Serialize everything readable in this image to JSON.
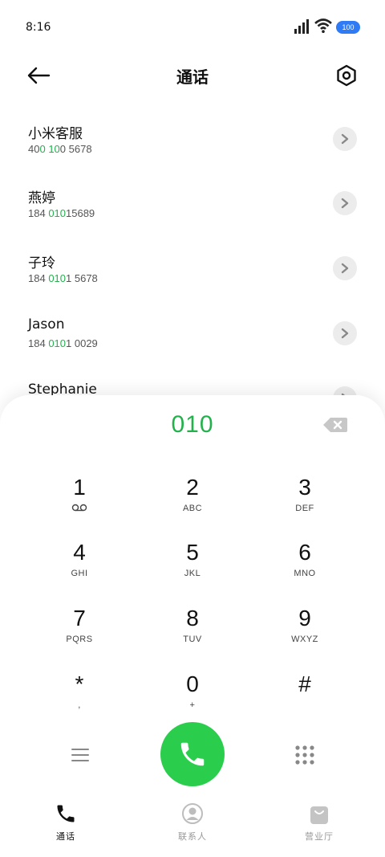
{
  "status": {
    "time": "8:16",
    "battery": "100"
  },
  "header": {
    "title": "通话"
  },
  "contacts": [
    {
      "name": "小米客服",
      "num_parts": [
        {
          "t": "40",
          "h": false
        },
        {
          "t": "0",
          "h": true
        },
        {
          "t": " ",
          "h": false
        },
        {
          "t": "10",
          "h": true
        },
        {
          "t": "0 5678",
          "h": false
        }
      ]
    },
    {
      "name": "燕婷",
      "num_parts": [
        {
          "t": "184 ",
          "h": false
        },
        {
          "t": "010",
          "h": true
        },
        {
          "t": "15689",
          "h": false
        }
      ]
    },
    {
      "name": "子玲",
      "num_parts": [
        {
          "t": "184 ",
          "h": false
        },
        {
          "t": "010",
          "h": true
        },
        {
          "t": "1 5678",
          "h": false
        }
      ]
    },
    {
      "name": "Jason",
      "num_parts": [
        {
          "t": "184 ",
          "h": false
        },
        {
          "t": "010",
          "h": true
        },
        {
          "t": "1 0029",
          "h": false
        }
      ]
    },
    {
      "name": "Stephanie",
      "num_parts": []
    }
  ],
  "dialer": {
    "input": "010",
    "keys": [
      {
        "digit": "1",
        "letters": ""
      },
      {
        "digit": "2",
        "letters": "ABC"
      },
      {
        "digit": "3",
        "letters": "DEF"
      },
      {
        "digit": "4",
        "letters": "GHI"
      },
      {
        "digit": "5",
        "letters": "JKL"
      },
      {
        "digit": "6",
        "letters": "MNO"
      },
      {
        "digit": "7",
        "letters": "PQRS"
      },
      {
        "digit": "8",
        "letters": "TUV"
      },
      {
        "digit": "9",
        "letters": "WXYZ"
      },
      {
        "digit": "*",
        "letters": ","
      },
      {
        "digit": "0",
        "letters": "+"
      },
      {
        "digit": "#",
        "letters": ""
      }
    ]
  },
  "nav": {
    "tabs": [
      {
        "label": "通话",
        "icon": "phone-icon",
        "active": true
      },
      {
        "label": "联系人",
        "icon": "contact-icon",
        "active": false
      },
      {
        "label": "营业厅",
        "icon": "bag-icon",
        "active": false
      }
    ]
  },
  "colors": {
    "accent": "#23b14d",
    "call": "#2bcd4d",
    "battery": "#2f7bf6"
  }
}
